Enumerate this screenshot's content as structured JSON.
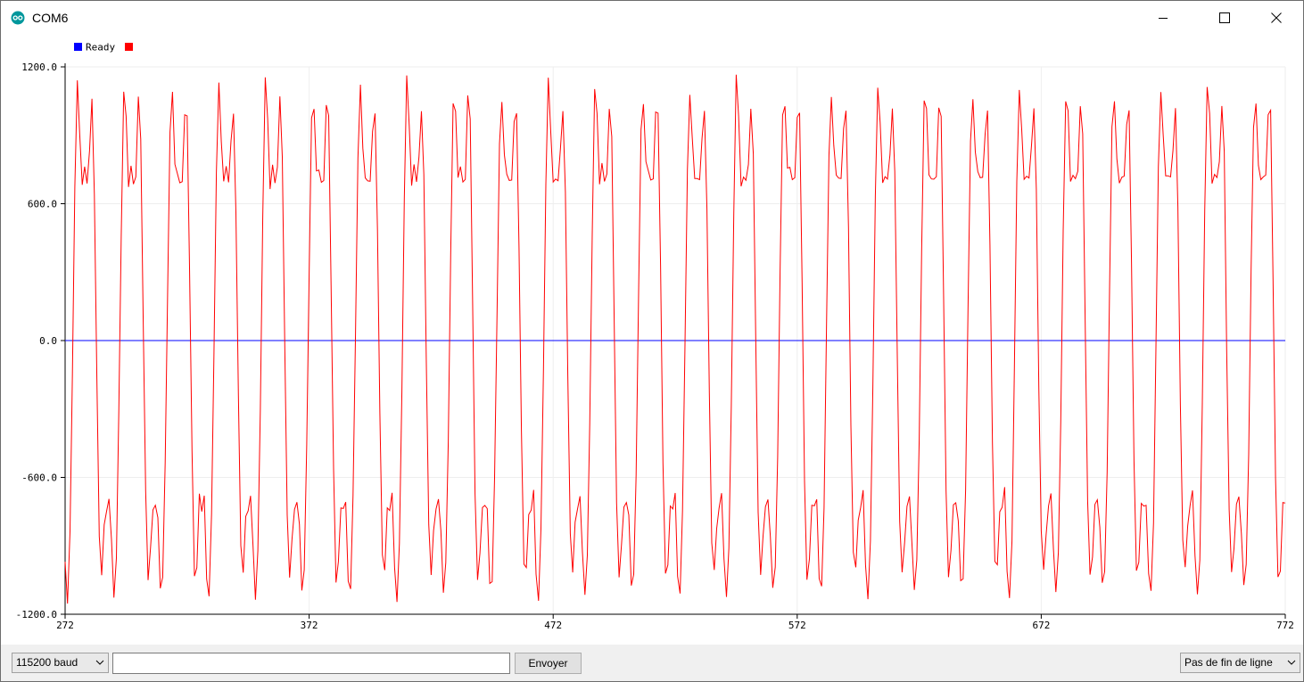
{
  "window": {
    "title": "COM6",
    "icon": "arduino-icon",
    "controls": [
      "minimize-icon",
      "maximize-icon",
      "close-icon"
    ]
  },
  "plotter": {
    "legend": {
      "label": "Ready",
      "colors": [
        "#0000ff",
        "#ff0000"
      ]
    }
  },
  "chart_data": {
    "type": "line",
    "title": "",
    "xlabel": "",
    "ylabel": "",
    "xlim": [
      272,
      772
    ],
    "ylim": [
      -1200,
      1200
    ],
    "x_ticks": [
      "272",
      "372",
      "472",
      "572",
      "672",
      "772"
    ],
    "y_ticks": [
      "1200.0",
      "600.0",
      "0.0",
      "-600.0",
      "-1200.0"
    ],
    "grid": true,
    "legend_position": "top-left",
    "series": [
      {
        "color": "#0000ff",
        "constant": 0
      },
      {
        "color": "#ff0000",
        "period_samples": 19.3,
        "pattern_values": [
          -1000,
          -1150,
          -900,
          -200,
          600,
          1150,
          1000,
          660,
          750,
          710,
          700,
          1050,
          1000,
          200,
          -600,
          -1050,
          -1000,
          -700,
          -740,
          -670
        ]
      }
    ]
  },
  "bottom": {
    "baud_selected": "115200 baud",
    "input_value": "",
    "input_placeholder": "",
    "send_label": "Envoyer",
    "line_ending_selected": "Pas de fin de ligne"
  }
}
